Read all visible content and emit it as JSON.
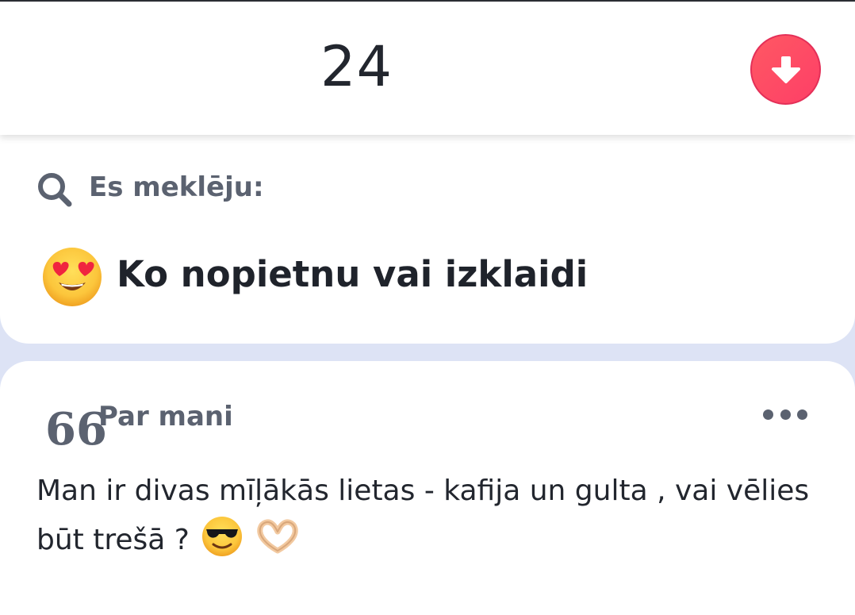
{
  "header": {
    "age": "24",
    "down_icon": "arrow-down-icon",
    "accent_color": "#fd4a65"
  },
  "seeking": {
    "icon": "search-icon",
    "title": "Es meklēju:",
    "emoji": "heart-eyes-emoji",
    "value": "Ko nopietnu vai izklaidi"
  },
  "about": {
    "icon": "quote-icon",
    "quote_glyph": "66",
    "title": "Par mani",
    "more_icon": "more-dots-icon",
    "text": "Man ir divas mīļākās lietas - kafija un gulta , vai vēlies būt trešā ?",
    "trailing_emojis": [
      "sunglasses-emoji",
      "heart-hands-emoji"
    ]
  }
}
